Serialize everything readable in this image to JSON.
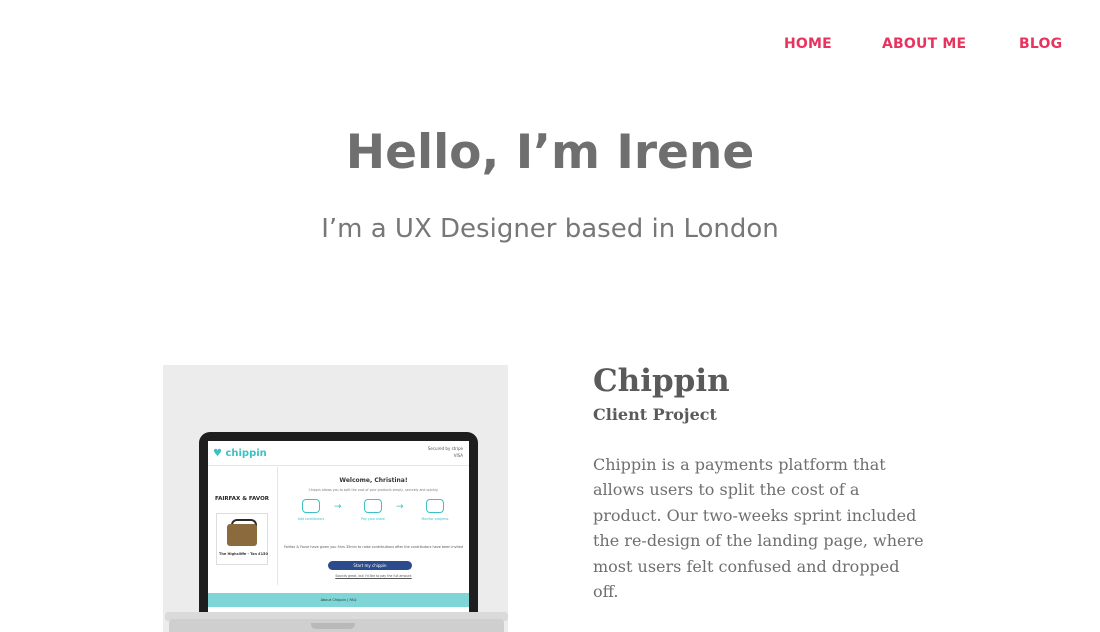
{
  "nav": {
    "home": "HOME",
    "about": "ABOUT ME",
    "blog": "BLOG"
  },
  "hero": {
    "title": "Hello, I’m Irene",
    "subtitle": "I’m a UX Designer based in London"
  },
  "project": {
    "title": "Chippin",
    "type": "Client Project",
    "description": "Chippin is a payments platform that allows users to split the cost of a product. Our two-weeks sprint included the re-design of the landing page, where most users felt confused and dropped off.",
    "screenshot": {
      "logo": "chippin",
      "secured_by": "Secured by stripe",
      "cards": "VISA",
      "brand": "FAIRFAX & FAVOR",
      "product_name": "The Highcliffe - Tan £150",
      "welcome": "Welcome, Christina!",
      "intro": "Chippin allows you to split the cost of your products simply, securely and quickly.",
      "steps": [
        "Add contributors",
        "Pay your share",
        "Monitor progress"
      ],
      "note": "Fairfax & Favor have given you 5hrs 35min to raise contributions after the contributors have been invited",
      "start_button": "Start my chippin",
      "link": "Sounds great, but I'd like to pay the full amount",
      "footer": "About Chippin  |  FAQ"
    }
  },
  "colors": {
    "accent": "#e8335f",
    "heading": "#6f6f6f",
    "chippin_teal": "#3bc2c4",
    "button_blue": "#2b4b8c"
  }
}
